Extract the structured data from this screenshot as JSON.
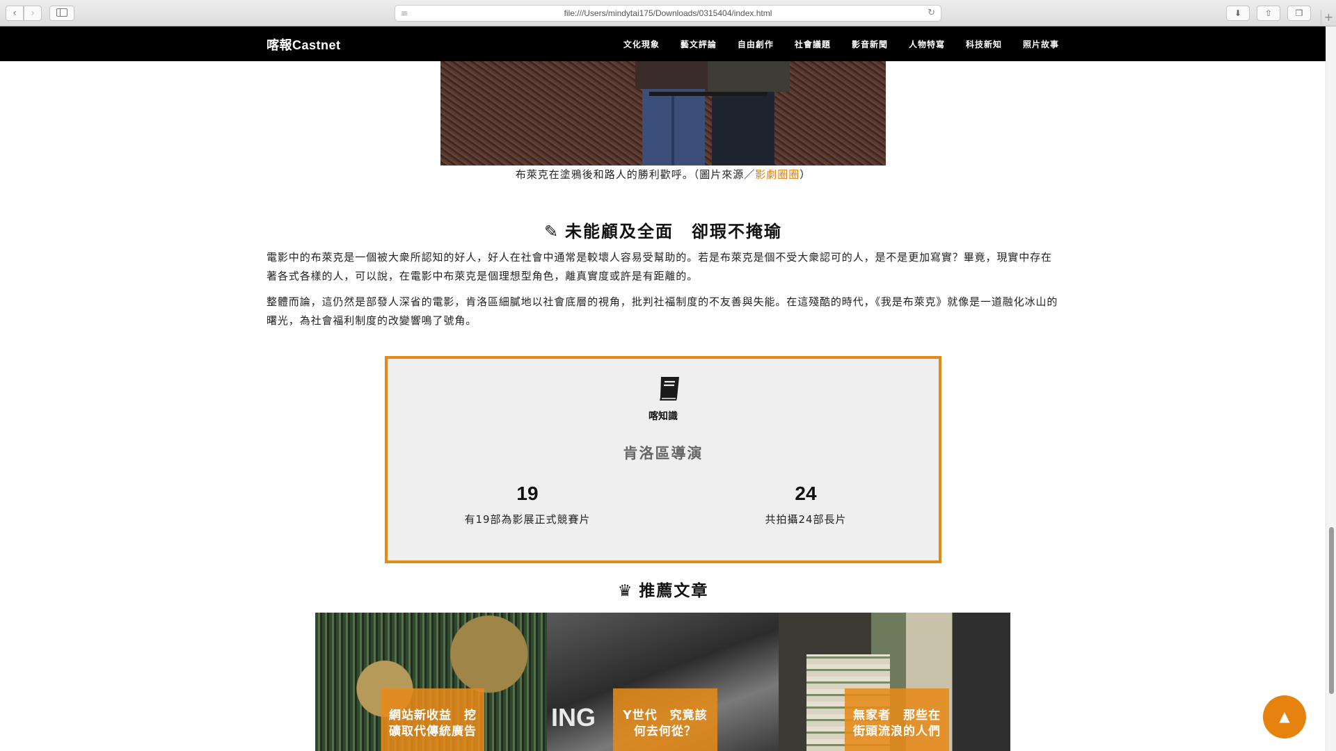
{
  "browser": {
    "url": "file:///Users/mindytai175/Downloads/0315404/index.html",
    "back_icon": "chevron-left",
    "forward_icon": "chevron-right"
  },
  "site": {
    "logo": "喀報Castnet",
    "nav": [
      "文化現象",
      "藝文評論",
      "自由創作",
      "社會議題",
      "影音新聞",
      "人物特寫",
      "科技新知",
      "照片故事"
    ]
  },
  "hero": {
    "caption_prefix": "布萊克在塗鴉後和路人的勝利歡呼。（圖片來源／",
    "caption_link": "影劇圈圈",
    "caption_suffix": "）"
  },
  "article": {
    "heading_icon": "✎",
    "heading": "未能顧及全面　卻瑕不掩瑜",
    "paragraphs": [
      "電影中的布萊克是一個被大衆所認知的好人，好人在社會中通常是較壞人容易受幫助的。若是布萊克是個不受大衆認可的人，是不是更加寫實？畢竟，現實中存在著各式各樣的人，可以說，在電影中布萊克是個理想型角色，離真實度或許是有距離的。",
      "整體而論，這仍然是部發人深省的電影，肯洛區細膩地以社會底層的視角，批判社福制度的不友善與失能。在這殘酷的時代，《我是布萊克》就像是一道融化冰山的曙光，為社會福利制度的改變響鳴了號角。"
    ]
  },
  "knowledge": {
    "label": "喀知識",
    "title": "肯洛區導演",
    "stats": [
      {
        "num": "19",
        "desc": "有19部為影展正式競賽片"
      },
      {
        "num": "24",
        "desc": "共拍攝24部長片"
      }
    ],
    "accent": "#e08a18"
  },
  "recommended": {
    "heading_icon": "♛",
    "heading": "推薦文章",
    "cards": [
      {
        "title": "網站新收益　挖礦取代傳統廣告"
      },
      {
        "title": "Y世代　究竟該何去何從？"
      },
      {
        "title": "無家者　那些在街頭流浪的人們"
      }
    ]
  },
  "to_top": "▲"
}
